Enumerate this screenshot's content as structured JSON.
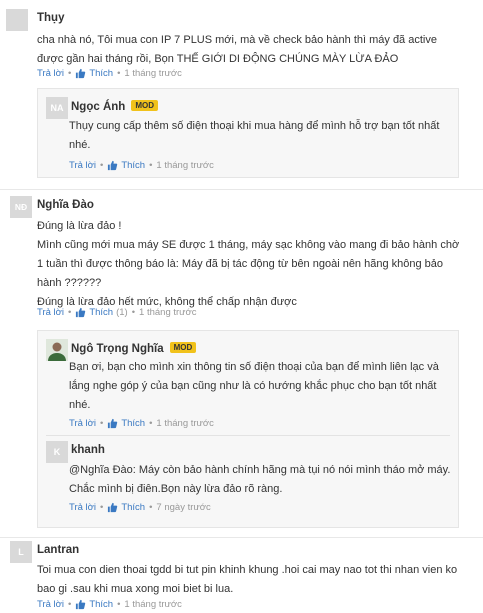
{
  "actions": {
    "reply": "Trả lời",
    "like": "Thích",
    "dot": "•"
  },
  "comments": [
    {
      "avatar": "",
      "name": "Thụy",
      "lines": [
        "cha nhà nó, Tôi mua con IP 7 PLUS mới, mà về check bảo hành thì máy đã active",
        "được gần hai tháng rồi, Bọn THẾ GIỚI DI ĐỘNG CHÚNG MÀY LỪA ĐẢO"
      ],
      "time": "1 tháng trước",
      "replies": [
        {
          "avatar": "NA",
          "name": "Ngọc Ánh",
          "badge": "MOD",
          "lines": [
            "Thụy cung cấp thêm số điện thoại khi mua hàng để mình hỗ trợ bạn tốt nhất",
            "nhé."
          ],
          "time": "1 tháng trước"
        }
      ]
    },
    {
      "avatar": "NĐ",
      "name": "Nghĩa Đào",
      "lines": [
        "Đúng là lừa đảo !",
        "Mình cũng mới mua máy SE được 1 tháng, máy sạc không vào mang đi bảo hành chờ",
        "1 tuần thì được thông báo là: Máy đã bị tác động từ bên ngoài nên hãng không bảo",
        "hành ??????",
        "Đúng là lừa đảo hết mức, không thể chấp nhận được"
      ],
      "like_count": "(1)",
      "time": "1 tháng trước",
      "replies": [
        {
          "avatar": "",
          "name": "Ngô Trọng Nghĩa",
          "badge": "MOD",
          "lines": [
            "Bạn ơi, bạn cho mình xin thông tin số điện thoại của bạn để mình liên lạc và",
            "lắng nghe góp ý của bạn cũng như là có hướng khắc phục cho bạn tốt nhất",
            "nhé."
          ],
          "time": "1 tháng trước"
        },
        {
          "avatar": "K",
          "name": "khanh",
          "lines": [
            "@Nghĩa Đào: Máy còn bảo hành chính hãng mà tụi nó nói mình tháo mở máy.",
            "Chắc mình bị điên.Bọn này lừa đảo rõ ràng."
          ],
          "time": "7 ngày trước"
        }
      ]
    },
    {
      "avatar": "L",
      "name": "Lantran",
      "lines": [
        "Toi mua con dien thoai tgdd bi tut pin khinh khung .hoi cai may nao tot thi nhan vien ko",
        "bao gi .sau khi mua xong moi biet bi lua."
      ],
      "time": "1 tháng trước"
    }
  ]
}
